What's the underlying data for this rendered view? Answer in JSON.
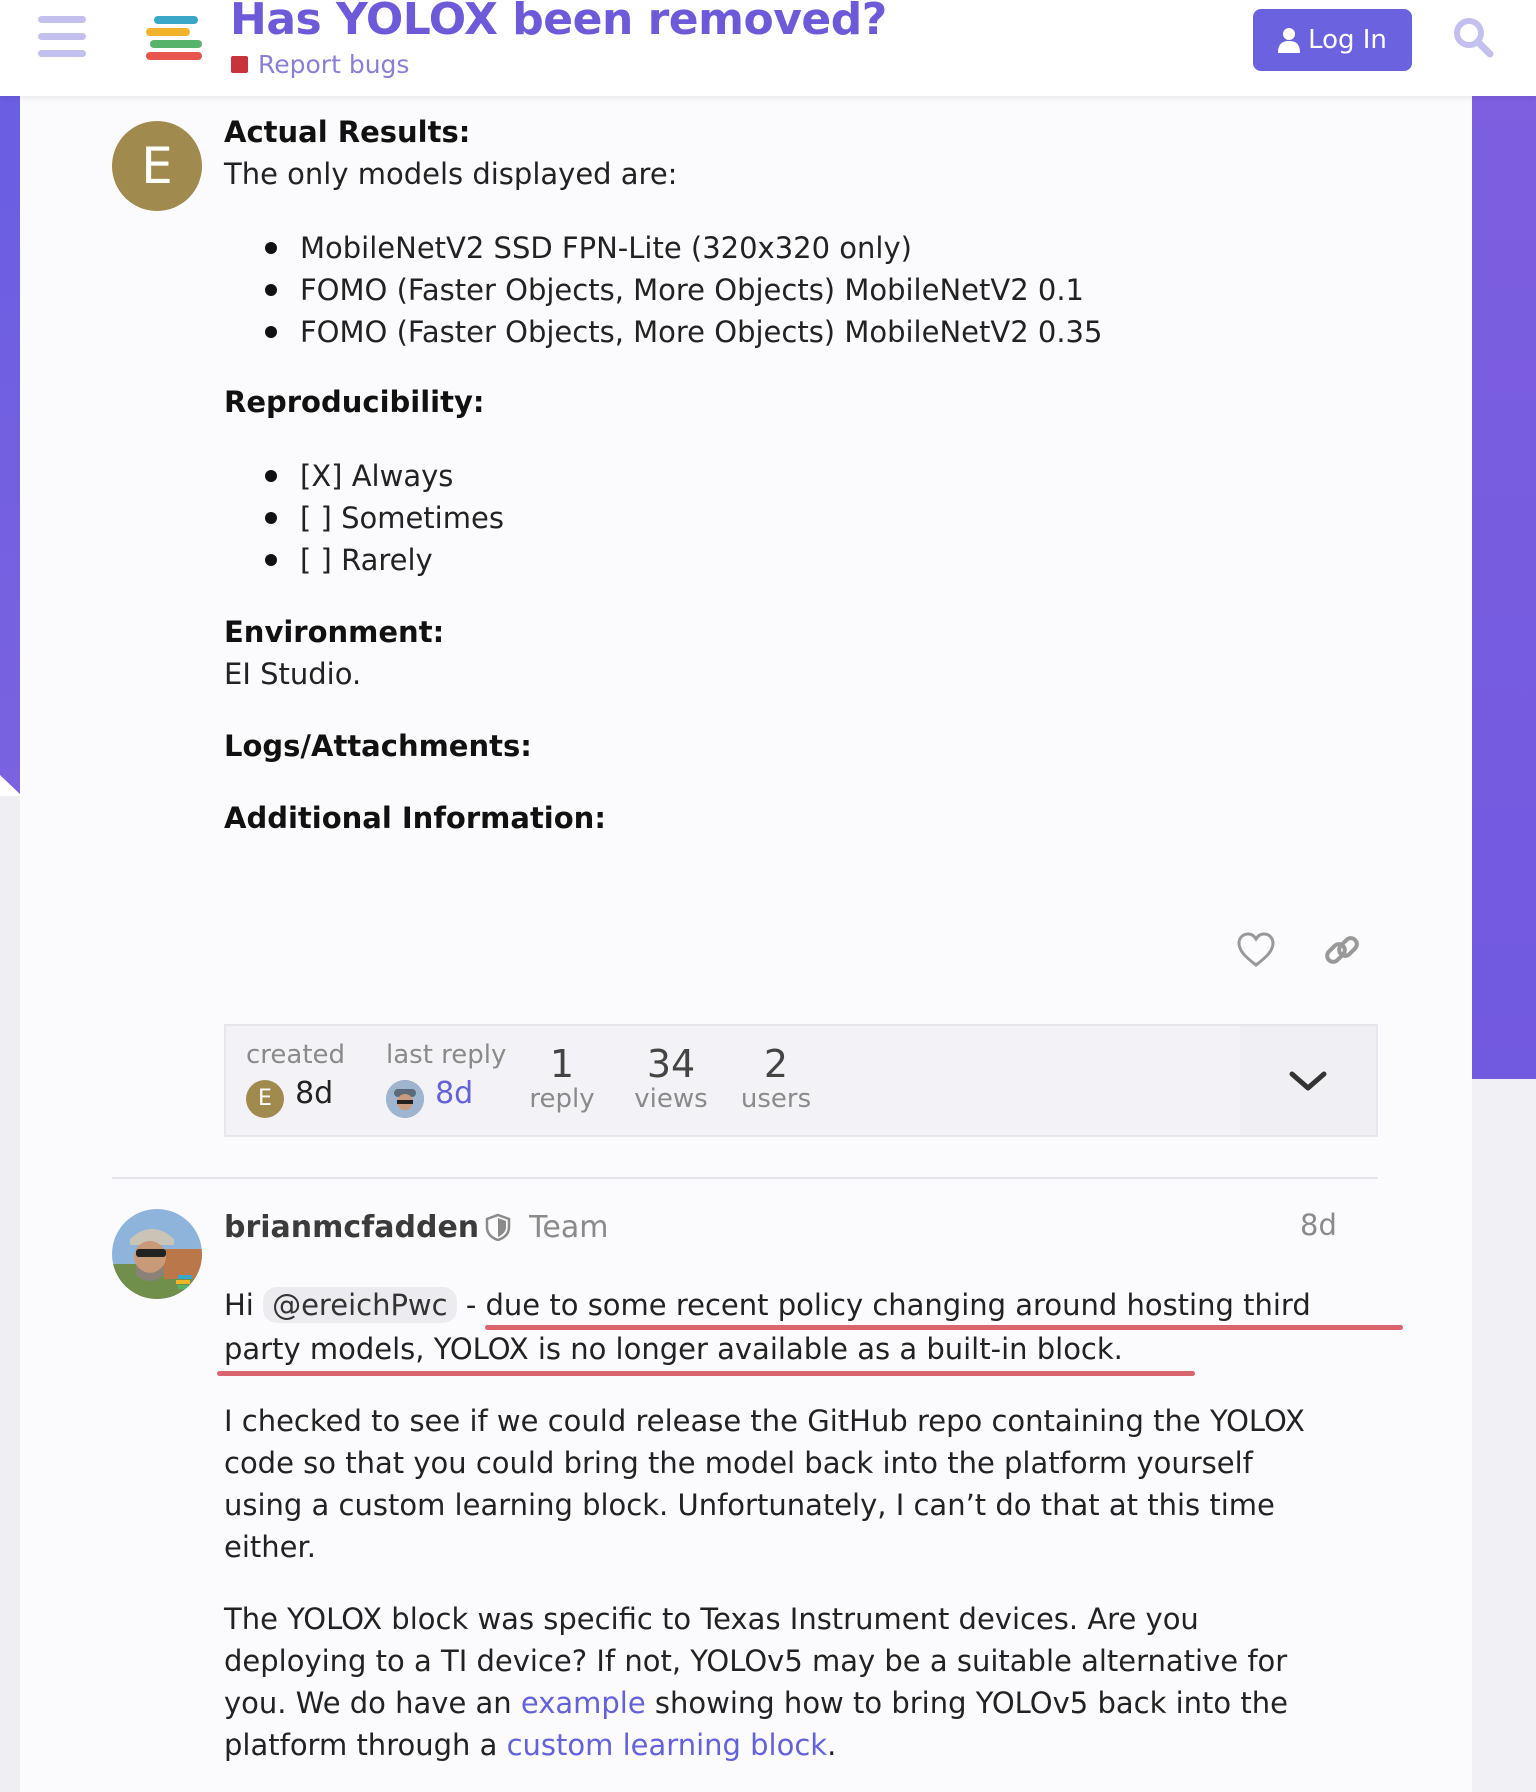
{
  "header": {
    "topic_title": "Has YOLOX been removed?",
    "category_label": "Report bugs",
    "category_color": "#c8333b",
    "login_label": "Log In",
    "accent_color": "#6a62df",
    "icons": [
      "menu-icon",
      "site-logo",
      "user-icon",
      "search-icon"
    ]
  },
  "post1": {
    "avatar_letter": "E",
    "actual_results_heading": "Actual Results:",
    "actual_results_text": "The only models displayed are:",
    "models": [
      "MobileNetV2 SSD FPN-Lite (320x320 only)",
      "FOMO (Faster Objects, More Objects) MobileNetV2 0.1",
      "FOMO (Faster Objects, More Objects) MobileNetV2 0.35"
    ],
    "reproducibility_heading": "Reproducibility:",
    "reproducibility": [
      "[X] Always",
      "[ ] Sometimes",
      "[ ] Rarely"
    ],
    "environment_heading": "Environment:",
    "environment_text": "EI Studio.",
    "logs_heading": "Logs/Attachments:",
    "additional_heading": "Additional Information:",
    "action_icons": [
      "heart-icon",
      "link-icon"
    ]
  },
  "topic_map": {
    "created_label": "created",
    "created_avatar_letter": "E",
    "created_value": "8d",
    "last_reply_label": "last reply",
    "last_reply_value": "8d",
    "replies_count": "1",
    "replies_label": "reply",
    "views_count": "34",
    "views_label": "views",
    "users_count": "2",
    "users_label": "users"
  },
  "post2": {
    "username": "brianmcfadden",
    "user_title": "Team",
    "date": "8d",
    "greeting": "Hi",
    "mention": "@ereichPwc",
    "line1_rest": " - due to some recent policy changing around hosting third",
    "line2": "party models, YOLOX is no longer available as a built-in block.",
    "para2": [
      "I checked to see if we could release the GitHub repo containing the YOLOX",
      "code so that you could bring the model back into the platform yourself",
      "using a custom learning block. Unfortunately, I can’t do that at this time",
      "either."
    ],
    "para3_line1": "The YOLOX block was specific to Texas Instrument devices. Are you",
    "para3_line2": "deploying to a TI device? If not, YOLOv5 may be a suitable alternative for",
    "para3_line3_before": "you. We do have an ",
    "para3_link1": "example",
    "para3_line3_after": " showing how to bring YOLOv5 back into the",
    "para3_line4_before": "platform through a ",
    "para3_link2": "custom learning block",
    "para3_line4_after": "."
  }
}
